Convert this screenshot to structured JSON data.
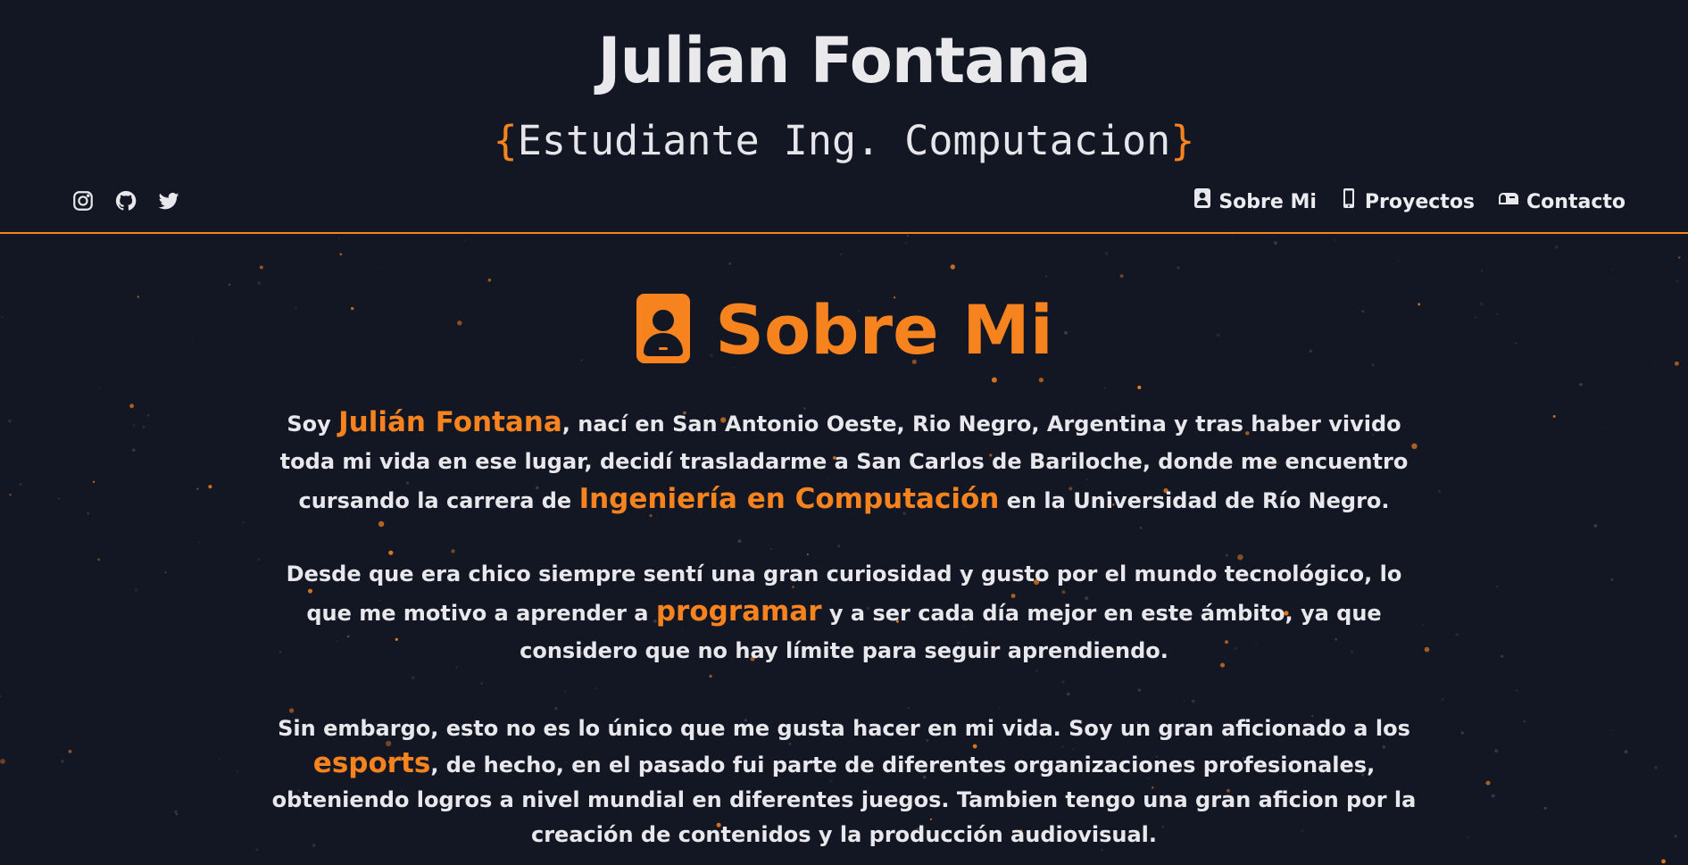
{
  "header": {
    "title": "Julian Fontana",
    "subtitle": {
      "open_brace": "{",
      "text": "Estudiante Ing. Computacion",
      "close_brace": "}"
    },
    "social": [
      {
        "icon": "instagram-icon"
      },
      {
        "icon": "github-icon"
      },
      {
        "icon": "twitter-icon"
      }
    ],
    "nav": [
      {
        "label": "Sobre Mi",
        "icon": "contact-card-icon"
      },
      {
        "label": "Proyectos",
        "icon": "phone-icon"
      },
      {
        "label": "Contacto",
        "icon": "mailbox-icon"
      }
    ]
  },
  "main": {
    "heading": "Sobre Mi",
    "heading_icon": "contact-card-icon",
    "p1": {
      "t1": "Soy ",
      "h1": "Julián Fontana",
      "t2": ", nací en San Antonio Oeste, Rio Negro, Argentina y tras haber vivido toda mi vida en ese lugar, decidí trasladarme a San Carlos de Bariloche, donde me encuentro cursando la carrera de ",
      "h2": "Ingeniería en Computación",
      "t3": " en la Universidad de Río Negro."
    },
    "p2": {
      "t1": "Desde que era chico siempre sentí una gran curiosidad y gusto por el mundo tecnológico, lo que me motivo a aprender a ",
      "h1": "programar",
      "t2": " y a ser cada día mejor en este ámbito, ya que considero que no hay límite para seguir aprendiendo."
    },
    "p3": {
      "t1": "Sin embargo, esto no es lo único que me gusta hacer en mi vida. Soy un gran aficionado a los ",
      "h1": "esports",
      "t2": ", de hecho, en el pasado fui parte de diferentes organizaciones profesionales, obteniendo logros a nivel mundial en diferentes juegos. Tambien tengo una gran aficion por la creación de contenidos y la producción audiovisual."
    }
  },
  "colors": {
    "background": "#131724",
    "accent": "#f7831f",
    "text": "#e8e8ec"
  }
}
